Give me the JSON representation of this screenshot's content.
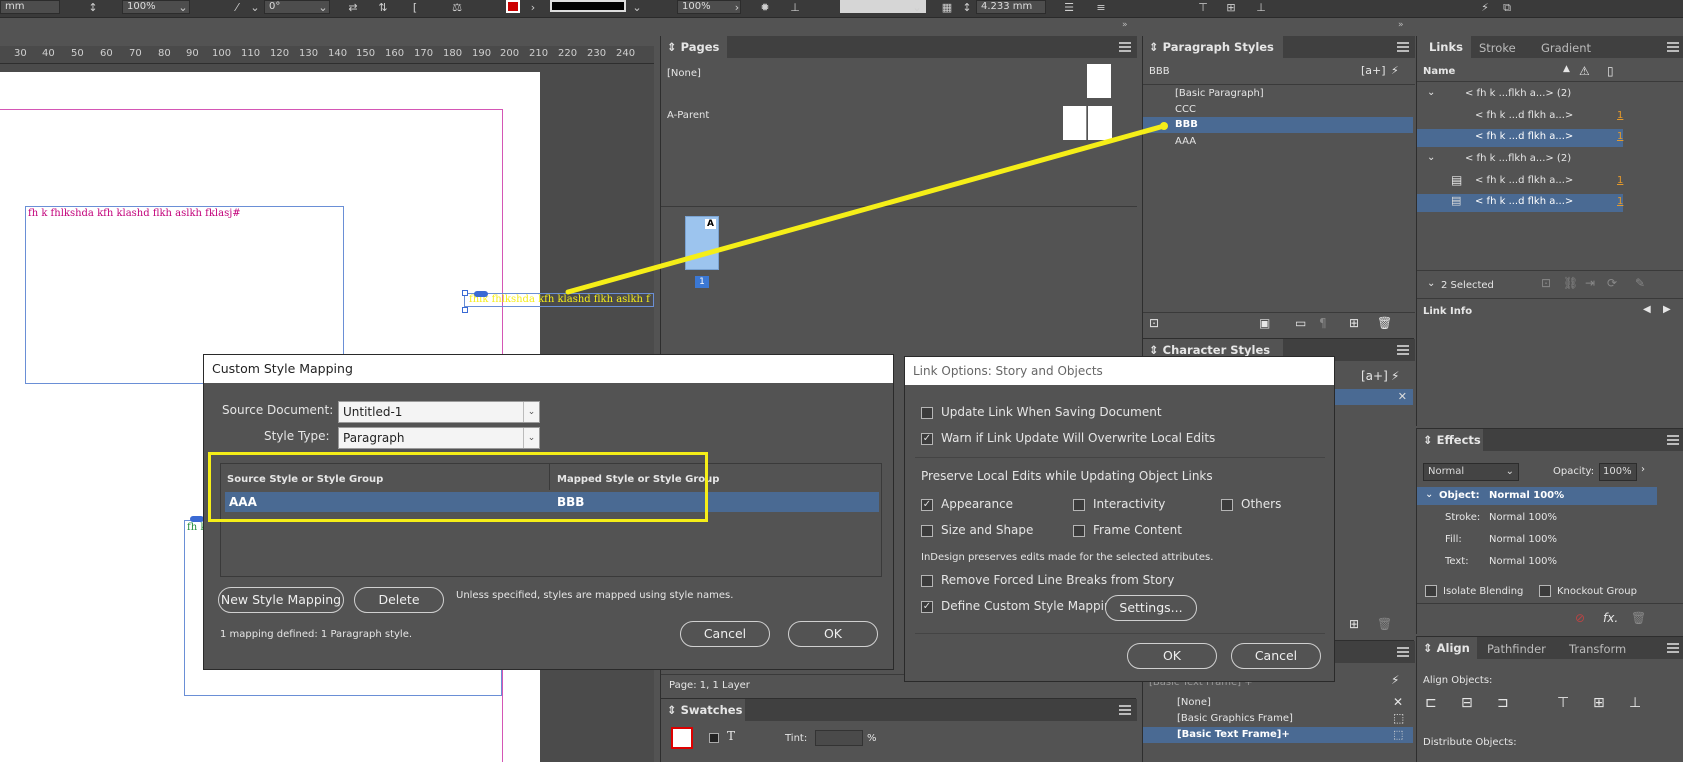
{
  "toolbar": {
    "units_field": "mm",
    "scale_field": "100%",
    "angle_field": "0°",
    "opacity_field": "100%",
    "measure_field": "4.233 mm"
  },
  "ruler": {
    "ticks": [
      "30",
      "40",
      "50",
      "60",
      "70",
      "80",
      "90",
      "100",
      "110",
      "120",
      "130",
      "140",
      "150",
      "160",
      "170",
      "180",
      "190",
      "200",
      "210",
      "220",
      "230",
      "240"
    ]
  },
  "canvas": {
    "frame1_text": "fh k fhlkshda kfh klashd flkh aslkh fklasj#",
    "frame2_text": "fhlk fhlkshda kfh klashd flkh aslkh f",
    "frame3_text": "fh k"
  },
  "pages_panel": {
    "tab": "Pages",
    "none_label": "[None]",
    "parent_label": "A-Parent",
    "page_badge": "A",
    "page_number": "1",
    "status": "Page: 1, 1 Layer"
  },
  "swatches_panel": {
    "tab": "Swatches",
    "tint_label": "Tint:",
    "percent": "%"
  },
  "para_styles_panel": {
    "tab": "Paragraph Styles",
    "current": "BBB",
    "items": [
      "[Basic Paragraph]",
      "CCC",
      "BBB",
      "AAA"
    ],
    "selected_index": 2
  },
  "char_styles_panel": {
    "tab": "Character Styles"
  },
  "object_styles_panel": {
    "header_partial": "[Basic Text Frame] +",
    "items": [
      "[None]",
      "[Basic Graphics Frame]",
      "[Basic Text Frame]+"
    ],
    "selected_index": 2
  },
  "links_panel": {
    "tabs": [
      "Links",
      "Stroke",
      "Gradient"
    ],
    "name_header": "Name",
    "rows": [
      {
        "text": "< fh k ...flkh a...> (2)",
        "count": "",
        "level": 0,
        "selected": false
      },
      {
        "text": "< fh k ...d flkh a...>",
        "count": "1",
        "level": 1,
        "selected": false
      },
      {
        "text": "< fh k ...d flkh a...>",
        "count": "1",
        "level": 1,
        "selected": true
      },
      {
        "text": "< fh k ...flkh a...> (2)",
        "count": "",
        "level": 0,
        "selected": false
      },
      {
        "text": "< fh k ...d flkh a...>",
        "count": "1",
        "level": 1,
        "selected": false
      },
      {
        "text": "< fh k ...d flkh a...>",
        "count": "1",
        "level": 1,
        "selected": true
      }
    ],
    "selected_count": "2 Selected",
    "link_info": "Link Info"
  },
  "effects_panel": {
    "tab": "Effects",
    "blend_mode": "Normal",
    "opacity_label": "Opacity:",
    "opacity_value": "100%",
    "rows": [
      {
        "label": "Object:",
        "value": "Normal 100%"
      },
      {
        "label": "Stroke:",
        "value": "Normal 100%"
      },
      {
        "label": "Fill:",
        "value": "Normal 100%"
      },
      {
        "label": "Text:",
        "value": "Normal 100%"
      }
    ],
    "isolate_blending": "Isolate Blending",
    "knockout_group": "Knockout Group"
  },
  "align_panel": {
    "tabs": [
      "Align",
      "Pathfinder",
      "Transform"
    ],
    "align_objects": "Align Objects:",
    "distribute_objects": "Distribute Objects:"
  },
  "custom_style_dialog": {
    "title": "Custom Style Mapping",
    "source_document_label": "Source Document:",
    "source_document_value": "Untitled-1",
    "style_type_label": "Style Type:",
    "style_type_value": "Paragraph",
    "col_source": "Source Style or Style Group",
    "col_mapped": "Mapped Style or Style Group",
    "mapping_source": "AAA",
    "mapping_target": "BBB",
    "new_mapping_button": "New Style Mapping",
    "delete_button": "Delete",
    "hint": "Unless specified, styles are mapped using style names.",
    "summary": "1 mapping defined:  1 Paragraph style.",
    "cancel_button": "Cancel",
    "ok_button": "OK"
  },
  "link_options_dialog": {
    "title": "Link Options: Story and Objects",
    "update_on_save": "Update Link When Saving Document",
    "update_on_save_checked": false,
    "warn_overwrite": "Warn if Link Update Will Overwrite Local Edits",
    "warn_overwrite_checked": true,
    "preserve_heading": "Preserve Local Edits while Updating Object Links",
    "appearance": "Appearance",
    "appearance_checked": true,
    "interactivity": "Interactivity",
    "interactivity_checked": false,
    "others": "Others",
    "others_checked": false,
    "size_shape": "Size and Shape",
    "size_shape_checked": false,
    "frame_content": "Frame Content",
    "frame_content_checked": false,
    "note": "InDesign preserves edits made for the selected attributes.",
    "remove_breaks": "Remove Forced Line Breaks from Story",
    "remove_breaks_checked": false,
    "define_mapping": "Define Custom Style Mapping",
    "define_mapping_checked": true,
    "settings_button": "Settings...",
    "ok_button": "OK",
    "cancel_button": "Cancel"
  },
  "colors": {
    "highlight_yellow": "#f5ee18",
    "selection_blue": "#4a6a93",
    "link_count_orange": "#e59a2b"
  }
}
